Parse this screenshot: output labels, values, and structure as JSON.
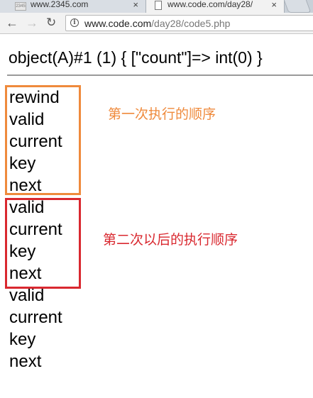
{
  "browser": {
    "tabs": [
      {
        "title": "www.2345.com",
        "favicon": "2345",
        "active": false
      },
      {
        "title": "www.code.com/day28/",
        "active": true
      }
    ],
    "close_glyph": "×",
    "address": {
      "host": "www.code.com",
      "path": "/day28/code5.php"
    }
  },
  "page": {
    "var_dump": "object(A)#1 (1) { [\"count\"]=> int(0) }",
    "lines": [
      "rewind",
      "valid",
      "current",
      "key",
      "next",
      "valid",
      "current",
      "key",
      "next",
      "valid",
      "current",
      "key",
      "next"
    ],
    "annotations": {
      "first": "第一次执行的顺序",
      "second": "第二次以后的执行顺序"
    }
  },
  "colors": {
    "first_box": "#ef8a3c",
    "second_box": "#d9282f"
  },
  "icons": [
    "document-icon",
    "close-icon",
    "back-arrow-icon",
    "forward-arrow-icon",
    "reload-icon",
    "info-icon",
    "new-tab-icon"
  ]
}
